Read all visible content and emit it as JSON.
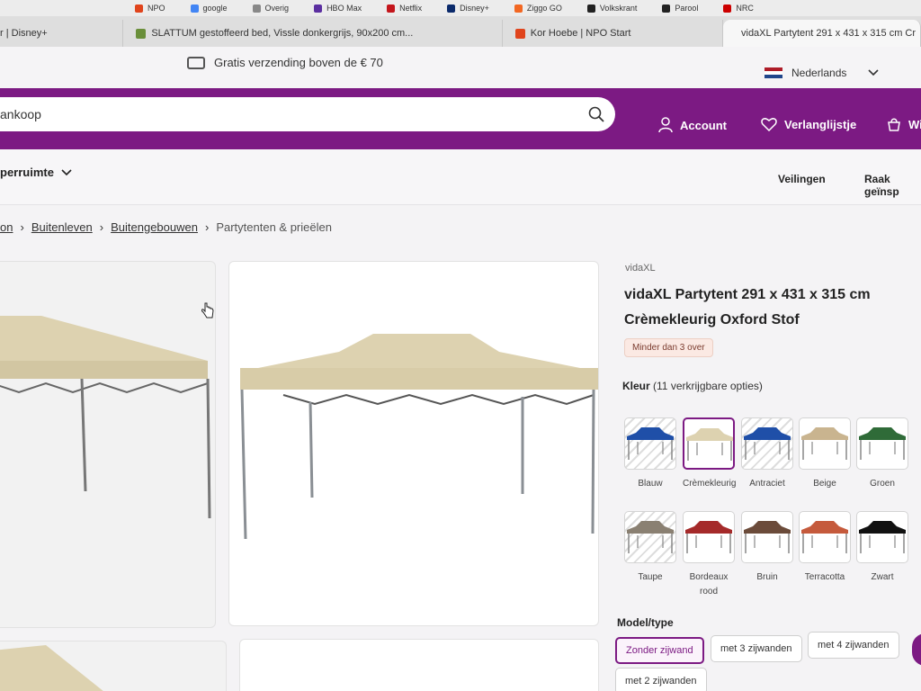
{
  "browser": {
    "bookmarks": [
      {
        "label": "NPO",
        "color": "#e0441c"
      },
      {
        "label": "google",
        "color": "#4285f4"
      },
      {
        "label": "Overig",
        "color": "#888888"
      },
      {
        "label": "HBO Max",
        "color": "#5b2fa0"
      },
      {
        "label": "Netflix",
        "color": "#c4161c"
      },
      {
        "label": "Disney+",
        "color": "#0b2a6b"
      },
      {
        "label": "Ziggo GO",
        "color": "#f26722"
      },
      {
        "label": "Volkskrant",
        "color": "#222222"
      },
      {
        "label": "Parool",
        "color": "#222222"
      },
      {
        "label": "NRC",
        "color": "#cc0000"
      }
    ],
    "tabs": [
      {
        "label": "r | Disney+",
        "color": "#0b2a6b"
      },
      {
        "label": "SLATTUM gestoffeerd bed, Vissle donkergrijs, 90x200 cm...",
        "color": "#6a8f3a"
      },
      {
        "label": "Kor Hoebe | NPO Start",
        "color": "#e0441c"
      },
      {
        "label": "vidaXL Partytent 291 x 431 x 315 cm Cr",
        "color": "#7c1a83"
      }
    ]
  },
  "topbar": {
    "shipping": "Gratis verzending boven de € 70",
    "language": "Nederlands"
  },
  "header": {
    "search_value": "ankoop",
    "account": "Account",
    "wishlist": "Verlanglijstje",
    "cart": "Wi"
  },
  "nav": {
    "category": "perruimte",
    "auctions": "Veilingen",
    "inspire": "Raak geïnsp"
  },
  "breadcrumb": [
    {
      "label": "on",
      "link": true
    },
    {
      "label": "Buitenleven",
      "link": true
    },
    {
      "label": "Buitengebouwen",
      "link": true
    },
    {
      "label": "Partytenten & prieëlen",
      "link": false
    }
  ],
  "product": {
    "brand": "vidaXL",
    "title_line1": "vidaXL Partytent 291 x 431 x 315 cm",
    "title_line2": "Crèmekleurig Oxford Stof",
    "stock": "Minder dan 3 over",
    "color_label": "Kleur",
    "color_options_count": "(11 verkrijgbare opties)",
    "colors": [
      {
        "name": "Blauw",
        "hex": "#1f4fa8",
        "hatch": true,
        "selected": false
      },
      {
        "name": "Crèmekleurig",
        "hex": "#ddd2b0",
        "hatch": false,
        "selected": true
      },
      {
        "name": "Antraciet",
        "hex": "#1f4fa8",
        "hatch": true,
        "selected": false
      },
      {
        "name": "Beige",
        "hex": "#c9b48f",
        "hatch": false,
        "selected": false
      },
      {
        "name": "Groen",
        "hex": "#2f6b38",
        "hatch": false,
        "selected": false
      },
      {
        "name": "Taupe",
        "hex": "#8a8072",
        "hatch": true,
        "selected": false
      },
      {
        "name": "Bordeaux rood",
        "hex": "#a52a2a",
        "hatch": false,
        "selected": false
      },
      {
        "name": "Bruin",
        "hex": "#6b4b3a",
        "hatch": false,
        "selected": false
      },
      {
        "name": "Terracotta",
        "hex": "#c55a3c",
        "hatch": false,
        "selected": false
      },
      {
        "name": "Zwart",
        "hex": "#111111",
        "hatch": false,
        "selected": false
      }
    ],
    "model_label": "Model/type",
    "models": [
      {
        "label": "Zonder zijwand",
        "selected": true
      },
      {
        "label": "met 3 zijwanden",
        "selected": false
      },
      {
        "label": "met 4 zijwanden",
        "selected": false
      },
      {
        "label": "met 2 zijwanden",
        "selected": false
      }
    ]
  },
  "colors": {
    "brand_purple": "#7c1a83",
    "tent_canvas": "#ddd2b0"
  }
}
